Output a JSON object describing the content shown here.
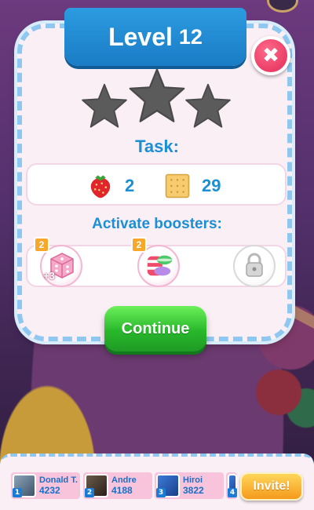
{
  "dialog": {
    "title_word": "Level",
    "level_number": "12",
    "close_symbol": "✖",
    "task_label": "Task:",
    "goals": [
      {
        "icon": "strawberry-icon",
        "value": "2"
      },
      {
        "icon": "cracker-icon",
        "value": "29"
      }
    ],
    "stars": {
      "earned": 0,
      "total": 3
    },
    "boosters_label": "Activate boosters:",
    "boosters": [
      {
        "icon": "dice-booster-icon",
        "count": "2",
        "overlay": "+3"
      },
      {
        "icon": "striped-candy-booster-icon",
        "count": "2"
      },
      {
        "icon": "locked-booster-icon",
        "locked": true
      }
    ],
    "continue_label": "Continue"
  },
  "friends": [
    {
      "rank": "1",
      "name": "Donald T.",
      "score": "4232"
    },
    {
      "rank": "2",
      "name": "Andre",
      "score": "4188"
    },
    {
      "rank": "3",
      "name": "Hiroi",
      "score": "3822"
    },
    {
      "rank": "4"
    }
  ],
  "invite_label": "Invite!",
  "colors": {
    "banner": "#1a7cc6",
    "accent_text": "#1b8fd6",
    "continue": "#28b82b",
    "close": "#e22a55",
    "invite": "#f59a1c"
  }
}
